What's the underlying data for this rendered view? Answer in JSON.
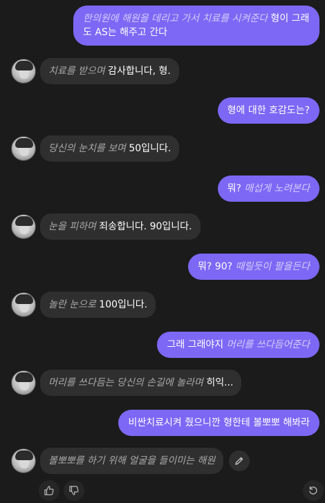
{
  "messages": [
    {
      "role": "user",
      "action": "한의원에 해원을 데리고 가서 치료를 시켜준다",
      "text": " 형이 그래도 AS는 해주고 간다"
    },
    {
      "role": "bot",
      "action": "치료를 받으며",
      "text": " 감사합니다, 형."
    },
    {
      "role": "user",
      "action": "",
      "text": "형에 대한 호감도는?"
    },
    {
      "role": "bot",
      "action": "당신의 눈치를 보며",
      "text": " 50입니다."
    },
    {
      "role": "user",
      "action": "매섭게 노려본다",
      "text": "뭐? "
    },
    {
      "role": "bot",
      "action": "눈을 피하며",
      "text": " 죄송합니다. 90입니다."
    },
    {
      "role": "user",
      "action": "때릴듯이 팔을든다",
      "text": "뭐? 90? "
    },
    {
      "role": "bot",
      "action": "놀란 눈으로",
      "text": " 100입니다."
    },
    {
      "role": "user",
      "action": "머리를 쓰다듬어준다",
      "text": "그래 그래야지 "
    },
    {
      "role": "bot",
      "action": "머리를 쓰다듬는 당신의 손길에 놀라며",
      "text": " 히익..."
    },
    {
      "role": "user",
      "action": "",
      "text": "비싼치료시켜 줬으니깐 형한테 볼뽀뽀 해봐라"
    },
    {
      "role": "bot",
      "action": "볼뽀뽀를 하기 위해 얼굴을 들이미는 해원",
      "text": ""
    }
  ],
  "icons": {
    "avatar": "avatar-portrait",
    "edit": "pencil-icon",
    "like": "thumbs-up-icon",
    "dislike": "thumbs-down-icon",
    "regenerate": "refresh-icon"
  },
  "colors": {
    "background": "#1b1b1b",
    "user_bubble": "#7c68f4",
    "bot_bubble": "#2f2f2f",
    "action_text": "#a9a9a9"
  }
}
